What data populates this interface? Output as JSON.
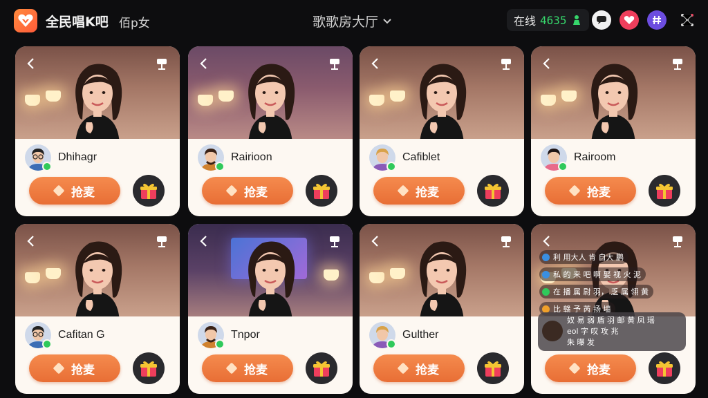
{
  "header": {
    "app_name": "全民唱K吧",
    "app_subtitle": "佰p女",
    "hall_title": "歌歌房大厅",
    "online_label": "在线",
    "online_count": "4635"
  },
  "colors": {
    "accent_orange": "#ef7a3f",
    "online_green": "#36d66b",
    "heart_red": "#ef3e5c",
    "hash_purple": "#6c4de0"
  },
  "rooms": [
    {
      "host": "Dhihagr",
      "grab_label": "抢麦",
      "scene": "warm",
      "avatar": "man-glasses"
    },
    {
      "host": "Rairioon",
      "grab_label": "抢麦",
      "scene": "purple",
      "avatar": "man-beard"
    },
    {
      "host": "Cafiblet",
      "grab_label": "抢麦",
      "scene": "warm",
      "avatar": "woman-blonde"
    },
    {
      "host": "Rairoom",
      "grab_label": "抢麦",
      "scene": "warm",
      "avatar": "woman-dark"
    },
    {
      "host": "Cafitan G",
      "grab_label": "抢麦",
      "scene": "warm",
      "avatar": "man-glasses"
    },
    {
      "host": "Tnpor",
      "grab_label": "抢麦",
      "scene": "tv",
      "avatar": "man-beard"
    },
    {
      "host": "Gulther",
      "grab_label": "抢麦",
      "scene": "warm",
      "avatar": "woman-blonde"
    },
    {
      "host": "",
      "grab_label": "抢麦",
      "scene": "warm",
      "avatar": "",
      "chat": true
    }
  ],
  "chat_messages": [
    "利 用大人 肯 自大 鹏 ",
    "私 的 来 吧 啊 娶 视 火 泥",
    "在 播 属 尉 羽， 乏 属 翎 黄",
    "比 赣 予 芮 扬 墙"
  ],
  "chat_card_lines": [
    "奴 易 弱 盾 羽 邮 黄 凤 瑶",
    "eol 字 叹 攻 兆",
    "朱 曝 发"
  ]
}
